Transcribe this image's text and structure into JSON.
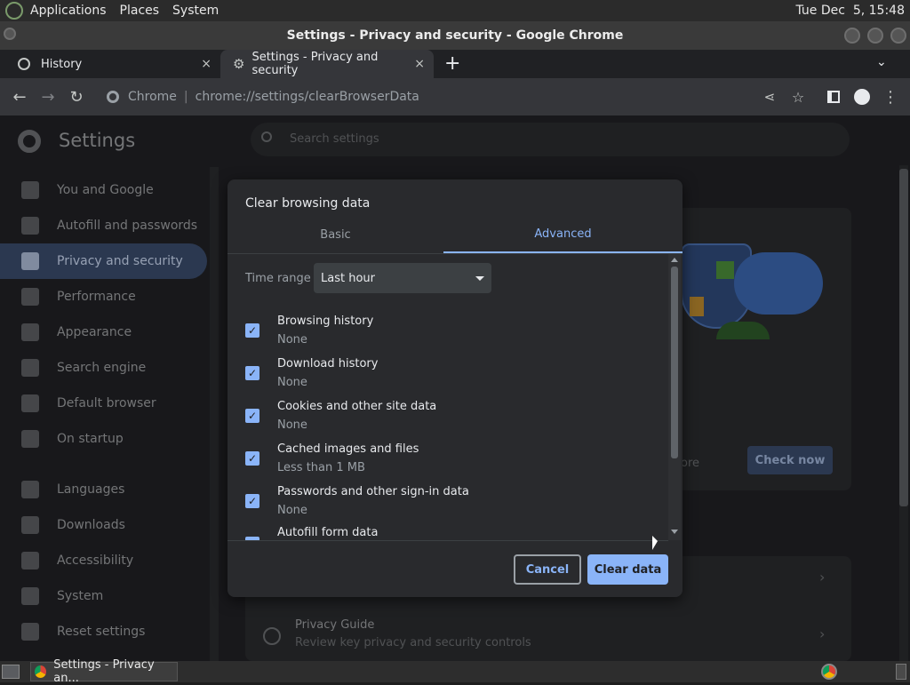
{
  "panel": {
    "menus": [
      "Applications",
      "Places",
      "System"
    ],
    "clock": "Tue Dec  5, 15:48"
  },
  "window": {
    "title": "Settings - Privacy and security - Google Chrome"
  },
  "tabs": [
    {
      "label": "History",
      "close": "×"
    },
    {
      "label": "Settings - Privacy and security",
      "close": "×"
    }
  ],
  "toolbar": {
    "omni_site": "Chrome",
    "omni_sep": "|",
    "omni_url_host": "chrome://settings/",
    "omni_url_path": "clearBrowserData"
  },
  "settings": {
    "title": "Settings",
    "search_placeholder": "Search settings",
    "sidebar": [
      {
        "label": "You and Google"
      },
      {
        "label": "Autofill and passwords"
      },
      {
        "label": "Privacy and security"
      },
      {
        "label": "Performance"
      },
      {
        "label": "Appearance"
      },
      {
        "label": "Search engine"
      },
      {
        "label": "Default browser"
      },
      {
        "label": "On startup"
      },
      {
        "label": "Languages"
      },
      {
        "label": "Downloads"
      },
      {
        "label": "Accessibility"
      },
      {
        "label": "System"
      },
      {
        "label": "Reset settings"
      }
    ],
    "check_now": "Check now",
    "partial_more": "ore",
    "privacy_guide": {
      "title": "Privacy Guide",
      "subtitle": "Review key privacy and security controls"
    }
  },
  "dialog": {
    "title": "Clear browsing data",
    "tabs": [
      "Basic",
      "Advanced"
    ],
    "time_range_label": "Time range",
    "time_range_value": "Last hour",
    "items": [
      {
        "title": "Browsing history",
        "sub": "None"
      },
      {
        "title": "Download history",
        "sub": "None"
      },
      {
        "title": "Cookies and other site data",
        "sub": "None"
      },
      {
        "title": "Cached images and files",
        "sub": "Less than 1 MB"
      },
      {
        "title": "Passwords and other sign-in data",
        "sub": "None"
      },
      {
        "title": "Autofill form data",
        "sub": ""
      }
    ],
    "cancel": "Cancel",
    "clear": "Clear data"
  },
  "taskbar": {
    "window_label": "Settings - Privacy an..."
  },
  "colors": {
    "accent": "#8ab4f8",
    "sidebar_selected": "#3a4b6b",
    "dialog_bg": "#292a2d"
  }
}
